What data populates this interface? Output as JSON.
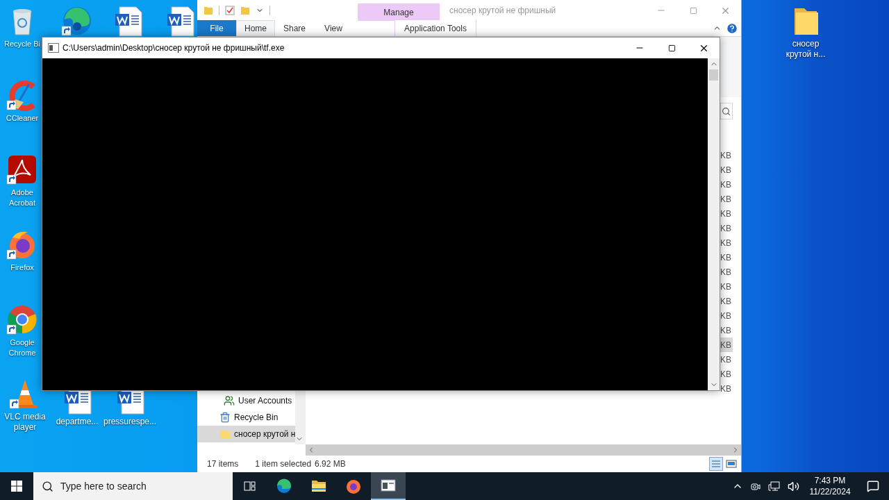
{
  "desktop_icons": [
    {
      "kind": "recycle",
      "label": "Recycle Bi",
      "shortcut": false
    },
    {
      "kind": "ccleaner",
      "label": "CCleaner",
      "shortcut": true
    },
    {
      "kind": "acrobat",
      "label": "Adobe Acrobat",
      "shortcut": true
    },
    {
      "kind": "firefox",
      "label": "Firefox",
      "shortcut": true
    },
    {
      "kind": "chrome",
      "label": "Google Chrome",
      "shortcut": true
    },
    {
      "kind": "vlc",
      "label": "VLC media player",
      "shortcut": true
    },
    {
      "kind": "edge",
      "shortcut": true
    },
    {
      "kind": "word",
      "shortcut": false
    },
    {
      "kind": "word",
      "shortcut": false
    },
    {
      "kind": "word",
      "label": "departme...",
      "shortcut": false
    },
    {
      "kind": "word",
      "label": "pressurespe...",
      "shortcut": false
    },
    {
      "kind": "folder",
      "label": "сносер крутой н...",
      "shortcut": false
    }
  ],
  "explorer": {
    "title": "сносер крутой не фришный",
    "context_tab": "Manage",
    "tabs": [
      {
        "label": "File",
        "kind": "file",
        "selected": false
      },
      {
        "label": "Home",
        "kind": "tab",
        "selected": true
      },
      {
        "label": "Share",
        "kind": "tab",
        "selected": false
      },
      {
        "label": "View",
        "kind": "tab",
        "selected": false
      },
      {
        "label": "Application Tools",
        "kind": "context",
        "selected": false
      }
    ],
    "nav_items": [
      {
        "label": "User Accounts",
        "kind": "users",
        "selected": false
      },
      {
        "label": "Recycle Bin",
        "kind": "recycle",
        "selected": false
      },
      {
        "label": "сносер крутой н",
        "kind": "folder",
        "selected": true
      }
    ],
    "files": [
      {
        "size": "KB",
        "selected": false
      },
      {
        "size": "KB",
        "selected": false
      },
      {
        "size": "KB",
        "selected": false
      },
      {
        "size": "KB",
        "selected": false
      },
      {
        "size": "KB",
        "selected": false
      },
      {
        "size": "KB",
        "selected": false
      },
      {
        "size": "KB",
        "selected": false
      },
      {
        "size": "KB",
        "selected": false
      },
      {
        "size": "KB",
        "selected": false
      },
      {
        "size": "KB",
        "selected": false
      },
      {
        "size": "KB",
        "selected": false
      },
      {
        "size": "KB",
        "selected": false
      },
      {
        "size": "KB",
        "selected": false
      },
      {
        "size": "KB",
        "selected": true
      },
      {
        "size": "KB",
        "selected": false
      },
      {
        "size": "KB",
        "selected": false
      },
      {
        "size": "KB",
        "selected": false
      }
    ],
    "status": {
      "count": "17 items",
      "selection": "1 item selected",
      "size": "6.92 MB"
    }
  },
  "console": {
    "title": "C:\\Users\\admin\\Desktop\\сносер крутой не фришный\\tf.exe"
  },
  "taskbar": {
    "search_placeholder": "Type here to search",
    "apps": [
      {
        "kind": "edge",
        "active": false
      },
      {
        "kind": "explorer",
        "active": false
      },
      {
        "kind": "firefox",
        "active": false
      },
      {
        "kind": "console",
        "active": true
      }
    ],
    "time": "7:43 PM",
    "date": "11/22/2024"
  }
}
